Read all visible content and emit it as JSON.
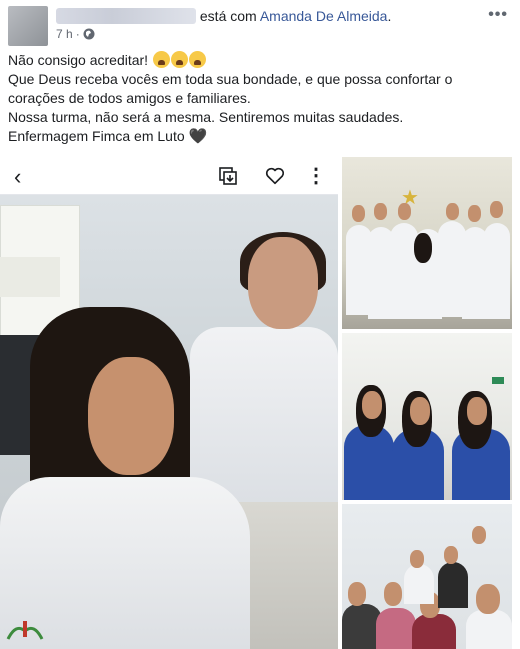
{
  "post": {
    "author_blurred": "",
    "with_text": "está com",
    "tagged_name": "Amanda De Almeida",
    "tagged_suffix": ".",
    "time": "7 h",
    "time_separator": "·",
    "privacy_icon": "globe-icon",
    "more_icon": "more-options-icon",
    "lines": [
      "Não consigo acreditar!",
      "Que Deus receba vocês em toda sua bondade, e que possa confortar o",
      "corações de todos amigos e familiares.",
      "Nossa turma, não será a mesma. Sentiremos muitas saudades.",
      "Enfermagem Fimca em Luto"
    ],
    "emoji_names": [
      "crying-face-emoji",
      "crying-face-emoji",
      "crying-face-emoji"
    ],
    "heart_glyph": "🖤"
  },
  "photo_toolbar": {
    "back_icon": "back-arrow-icon",
    "share_icon": "share-icon",
    "like_icon": "heart-icon",
    "more_icon": "vertical-more-icon"
  },
  "photos": {
    "count_visible": 4
  },
  "colors": {
    "link": "#385898",
    "text": "#1c1e21",
    "meta": "#616770",
    "scrub_shirts": "#2b4fa8"
  }
}
